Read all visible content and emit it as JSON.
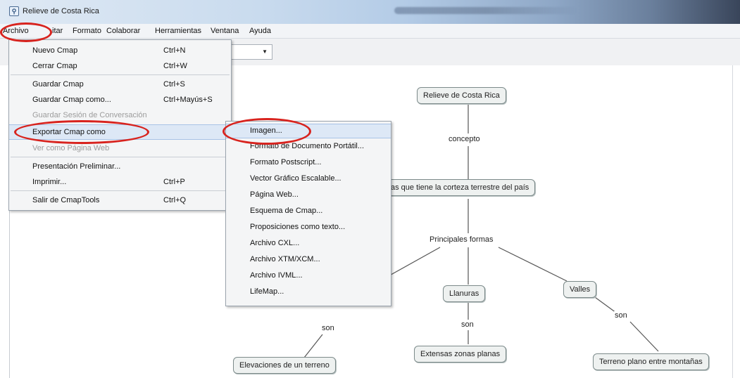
{
  "window": {
    "title": "Relieve de Costa Rica",
    "icon": "cmap-app-icon"
  },
  "menubar": {
    "items": [
      "Archivo",
      "Editar",
      "Formato",
      "Colaborar",
      "Herramientas",
      "Ventana",
      "Ayuda"
    ],
    "editar_partial": "itar"
  },
  "file_menu": {
    "items": [
      {
        "label": "Nuevo Cmap",
        "shortcut": "Ctrl+N"
      },
      {
        "label": "Cerrar Cmap",
        "shortcut": "Ctrl+W"
      },
      {
        "label": "Guardar Cmap",
        "shortcut": "Ctrl+S"
      },
      {
        "label": "Guardar Cmap como...",
        "shortcut": "Ctrl+Mayús+S"
      },
      {
        "label": "Guardar Sesión de Conversación",
        "shortcut": "",
        "disabled": true
      },
      {
        "label": "Exportar Cmap como",
        "shortcut": "",
        "highlighted": true
      },
      {
        "label": "Ver como Página Web",
        "shortcut": "",
        "disabled": true
      },
      {
        "label": "Presentación Preliminar...",
        "shortcut": ""
      },
      {
        "label": "Imprimir...",
        "shortcut": "Ctrl+P"
      },
      {
        "label": "Salir de CmapTools",
        "shortcut": "Ctrl+Q"
      }
    ]
  },
  "export_submenu": {
    "items": [
      "Imagen...",
      "Formato de Documento Portátil...",
      "Formato Postscript...",
      "Vector Gráfico Escalable...",
      "Página Web...",
      "Esquema de Cmap...",
      "Proposiciones como texto...",
      "Archivo CXL...",
      "Archivo XTM/XCM...",
      "Archivo IVML...",
      "LifeMap..."
    ]
  },
  "cmap": {
    "root": "Relieve de Costa Rica",
    "link_concepto": "concepto",
    "definition": "as que tiene la corteza terrestre del país",
    "link_principales": "Principales formas",
    "llanuras": "Llanuras",
    "valles": "Valles",
    "son_1": "son",
    "son_2": "son",
    "son_3": "son",
    "elevaciones": "Elevaciones de un terreno",
    "extensas": "Extensas zonas planas",
    "terreno": "Terreno plano entre montañas"
  },
  "colors": {
    "annotation_red": "#d8231e",
    "highlight": "#dde8f6"
  }
}
